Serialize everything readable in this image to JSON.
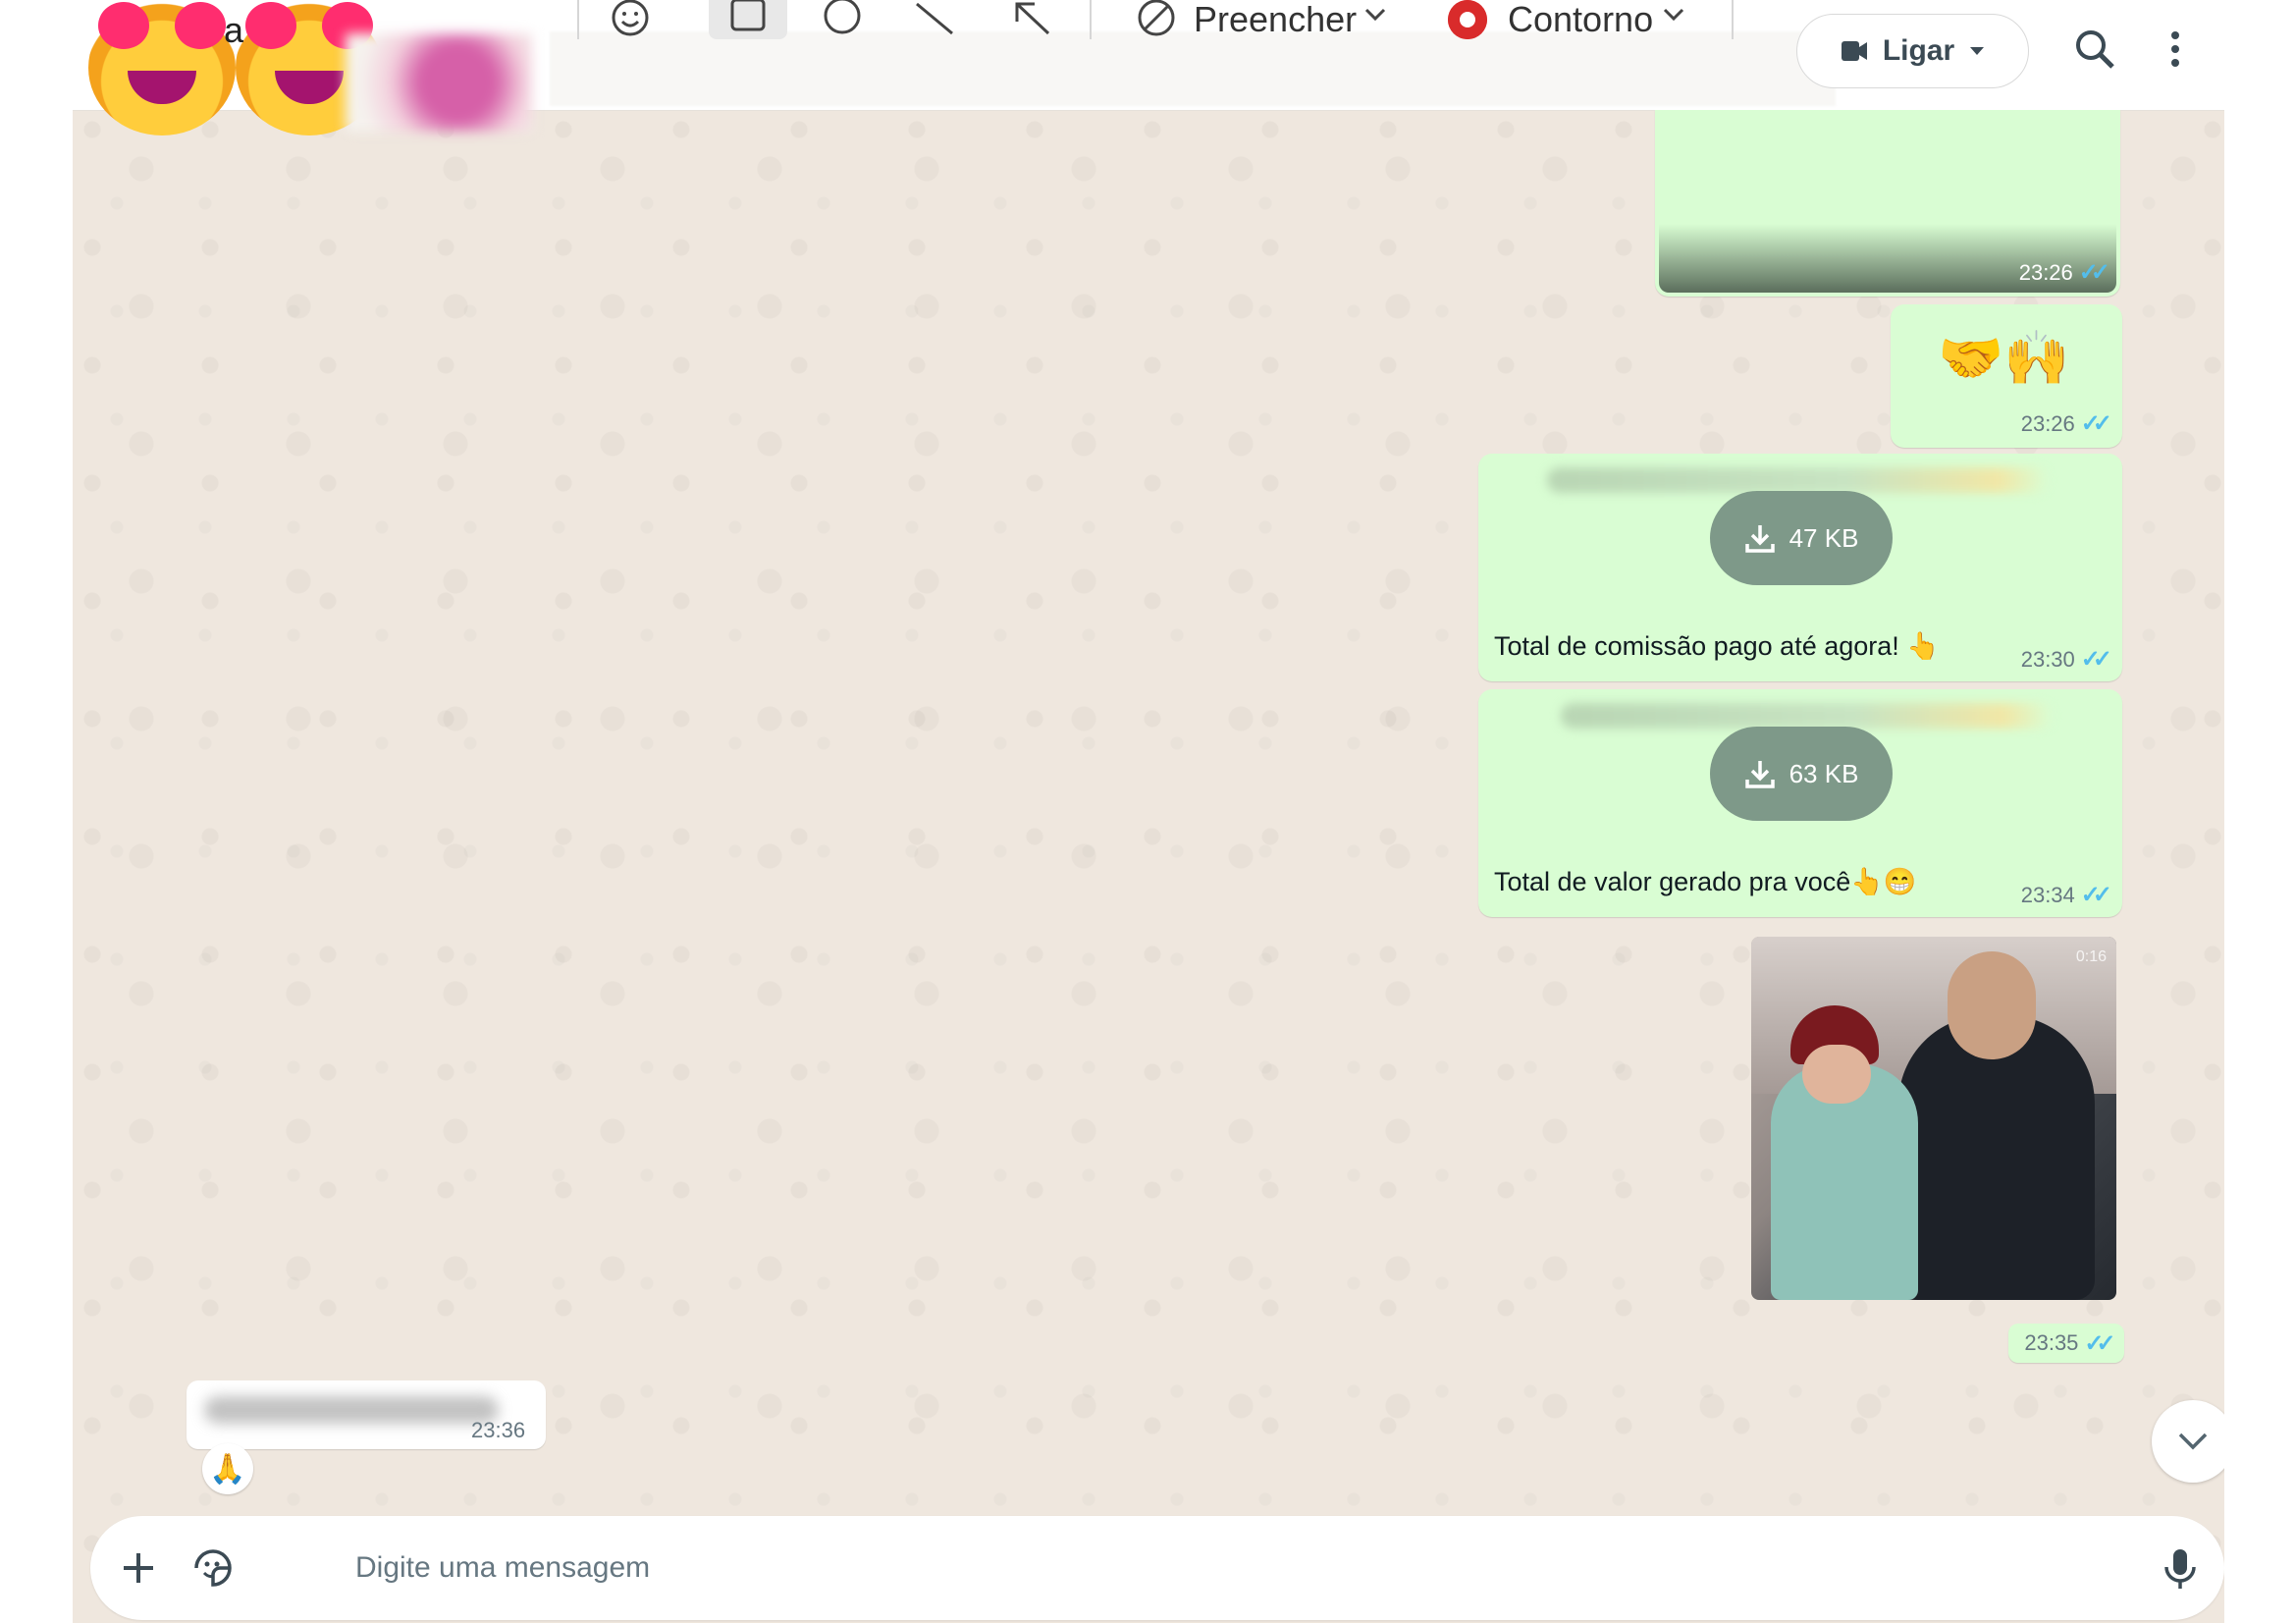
{
  "header": {
    "contact_initial": "a",
    "toolbar": {
      "fill_label": "Preencher",
      "outline_label": "Contorno"
    },
    "call_label": "Ligar"
  },
  "messages": [
    {
      "time": "23:26"
    },
    {
      "emoji": "🤝🙌",
      "time": "23:26"
    },
    {
      "file_size": "47 KB",
      "caption": "Total de comissão pago até agora! 👆",
      "time": "23:30"
    },
    {
      "file_size": "63 KB",
      "caption": "Total de valor gerado pra você👆😁",
      "time": "23:34"
    },
    {
      "video_duration": "0:16",
      "time": "23:35"
    }
  ],
  "incoming": {
    "time": "23:36",
    "reaction": "🙏"
  },
  "composer": {
    "placeholder": "Digite uma mensagem"
  },
  "colors": {
    "outgoing_bubble": "#d9fdd3",
    "chat_background": "#efe7de",
    "read_ticks": "#53bdeb",
    "download_pill": "#7e9989"
  },
  "icons": [
    "smiley-icon",
    "square-icon",
    "circle-icon",
    "line-icon",
    "arrow-icon",
    "fill-icon",
    "outline-icon",
    "video-call-icon",
    "search-icon",
    "menu-icon",
    "download-icon",
    "chevron-down-icon",
    "plus-icon",
    "sticker-icon",
    "mic-icon"
  ]
}
